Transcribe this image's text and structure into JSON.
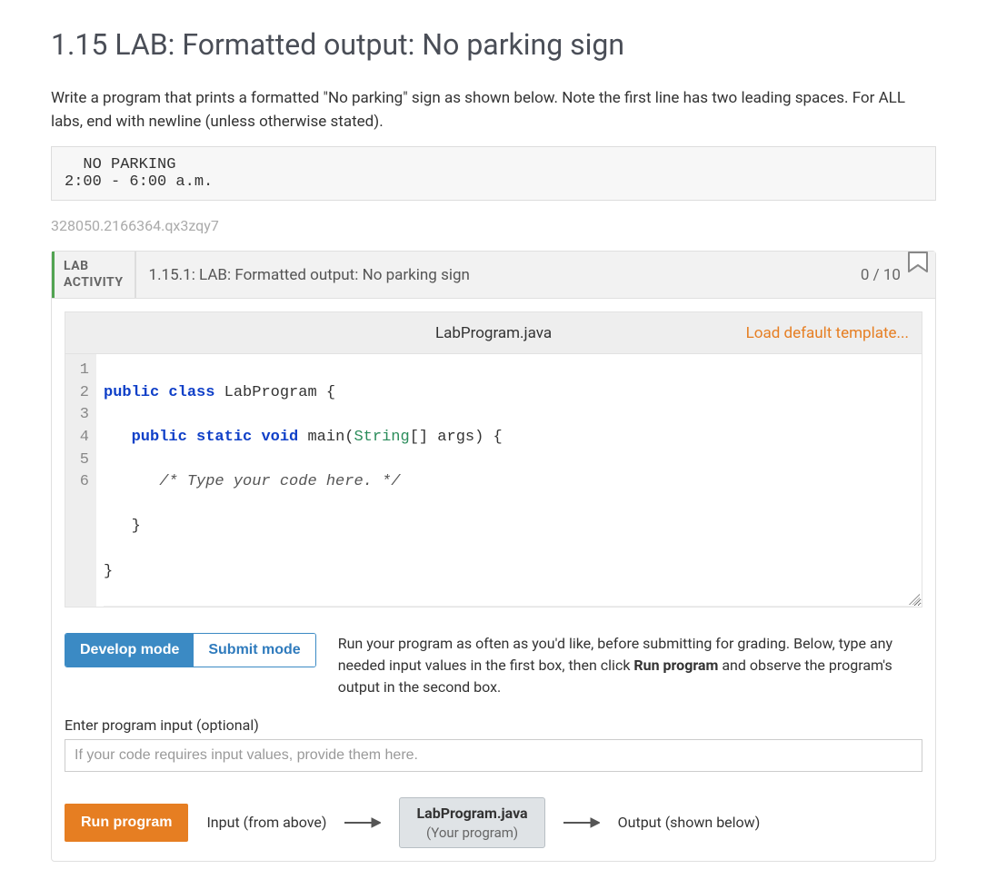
{
  "page": {
    "title": "1.15 LAB: Formatted output: No parking sign",
    "description": "Write a program that prints a formatted \"No parking\" sign as shown below. Note the first line has two leading spaces. For ALL labs, end with newline (unless otherwise stated).",
    "sample_output": "  NO PARKING\n2:00 - 6:00 a.m.",
    "hash": "328050.2166364.qx3zqy7"
  },
  "activity": {
    "tag_line1": "LAB",
    "tag_line2": "ACTIVITY",
    "title": "1.15.1: LAB: Formatted output: No parking sign",
    "score": "0 / 10"
  },
  "editor": {
    "filename": "LabProgram.java",
    "load_template_label": "Load default template...",
    "line_numbers": [
      "1",
      "2",
      "3",
      "4",
      "5",
      "6"
    ]
  },
  "code_tokens": {
    "l1": {
      "a": "public",
      "b": "class",
      "c": "LabProgram {"
    },
    "l2": {
      "a": "public",
      "b": "static",
      "c": "void",
      "d": "main(",
      "e": "String",
      "f": "[] args) {"
    },
    "l3": {
      "a": "/* Type your code here. */"
    },
    "l4": {
      "a": "   }"
    },
    "l5": {
      "a": "}"
    }
  },
  "modes": {
    "develop": "Develop mode",
    "submit": "Submit mode",
    "help_prefix": "Run your program as often as you'd like, before submitting for grading. Below, type any needed input values in the first box, then click ",
    "help_bold": "Run program",
    "help_suffix": " and observe the program's output in the second box."
  },
  "input": {
    "label": "Enter program input (optional)",
    "placeholder": "If your code requires input values, provide them here."
  },
  "run": {
    "button": "Run program",
    "input_label": "Input (from above)",
    "prog_file": "LabProgram.java",
    "prog_sub": "(Your program)",
    "output_label": "Output (shown below)"
  }
}
